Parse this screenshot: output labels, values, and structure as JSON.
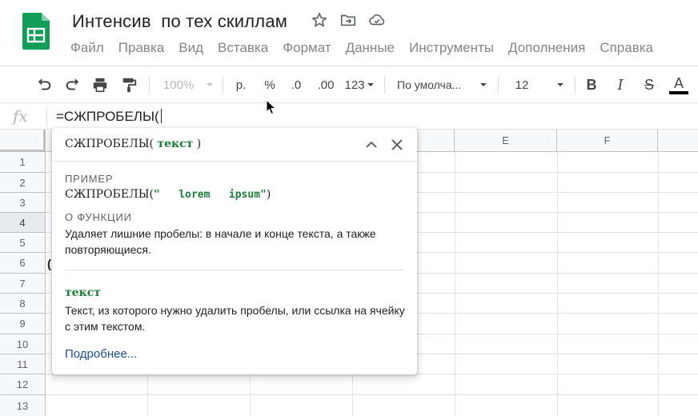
{
  "header": {
    "title": "Интенсив  по тех скиллам",
    "icons": [
      "sheets-logo-icon",
      "star-icon",
      "move-folder-icon",
      "cloud-saved-icon"
    ]
  },
  "menu": [
    "Файл",
    "Правка",
    "Вид",
    "Вставка",
    "Формат",
    "Данные",
    "Инструменты",
    "Дополнения",
    "Справка"
  ],
  "toolbar": {
    "zoom": "100%",
    "currency": "р.",
    "percent": "%",
    "decrease_decimal": ".0",
    "increase_decimal": ".00",
    "more_formats": "123",
    "font": "По умолча...",
    "font_size": "12",
    "bold": "B",
    "italic": "I",
    "strike": "S",
    "text_color": "A"
  },
  "formula_bar": {
    "fx": "fx",
    "formula": "=СЖПРОБЕЛЫ("
  },
  "columns": [
    "E",
    "F"
  ],
  "rows": [
    "1",
    "2",
    "3",
    "4",
    "5",
    "6",
    "7",
    "8",
    "9",
    "10",
    "11",
    "12",
    "13"
  ],
  "selected_row": "4",
  "cell_fragment": "(",
  "popup": {
    "func_name": "СЖПРОБЕЛЫ",
    "open_paren": "(",
    "arg": "текст",
    "close_paren": ")",
    "example_label": "ПРИМЕР",
    "example_func": "СЖПРОБЕЛЫ(",
    "example_arg": "\"   lorem   ipsum\"",
    "example_close": ")",
    "about_label": "О ФУНКЦИИ",
    "about_text": "Удаляет лишние пробелы: в начале и конце текста, а также повторяющиеся.",
    "arg_name": "текст",
    "arg_desc": "Текст, из которого нужно удалить пробелы, или ссылка на ячейку с этим текстом.",
    "more_link": "Подробнее..."
  },
  "colors": {
    "accent_green": "#188038",
    "link_blue": "#1a4d9c",
    "sheets_green": "#0f9d58"
  }
}
